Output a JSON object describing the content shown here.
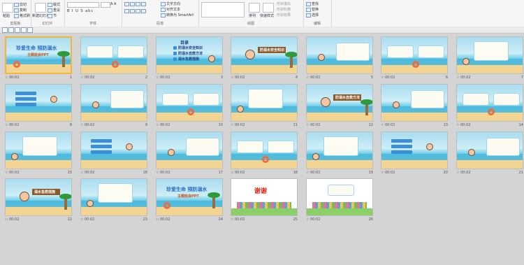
{
  "ribbon": {
    "groups": [
      {
        "label": "剪贴板",
        "items": [
          "剪切",
          "复制",
          "格式刷"
        ],
        "big": "粘贴"
      },
      {
        "label": "幻灯片",
        "items": [
          "版式",
          "重设",
          "节"
        ],
        "big": "新建幻灯片"
      },
      {
        "label": "字体",
        "items": [
          "A A",
          "B I U S abc"
        ]
      },
      {
        "label": "段落",
        "items": [
          "文字方向",
          "对齐文本",
          "转换为 SmartArt"
        ]
      },
      {
        "label": "绘图",
        "items": [
          "排列",
          "快速样式"
        ],
        "sub": [
          "形状填充",
          "形状轮廓",
          "形状效果"
        ]
      },
      {
        "label": "编辑",
        "items": [
          "查找",
          "替换",
          "选择"
        ]
      }
    ]
  },
  "slides": [
    {
      "n": "1",
      "time": "00:02",
      "title": "珍爱生命 预防溺水",
      "subtitle": "主题班会PPT"
    },
    {
      "n": "2",
      "time": "00:02"
    },
    {
      "n": "3",
      "time": "00:02",
      "title": "目录",
      "toc": [
        "防溺水安全知识",
        "防溺水自救方法",
        "溺水急救措施"
      ]
    },
    {
      "n": "4",
      "time": "00:02",
      "label": "防溺水安全知识"
    },
    {
      "n": "5",
      "time": "00:02"
    },
    {
      "n": "6",
      "time": "00:02"
    },
    {
      "n": "7",
      "time": "00:02"
    },
    {
      "n": "8",
      "time": "00:02"
    },
    {
      "n": "9",
      "time": "00:02"
    },
    {
      "n": "10",
      "time": "00:02"
    },
    {
      "n": "11",
      "time": "00:02"
    },
    {
      "n": "12",
      "time": "00:02",
      "label": "防溺水自救方法"
    },
    {
      "n": "13",
      "time": "00:02"
    },
    {
      "n": "14",
      "time": "00:02"
    },
    {
      "n": "15",
      "time": "00:02"
    },
    {
      "n": "16",
      "time": "00:02"
    },
    {
      "n": "17",
      "time": "00:02"
    },
    {
      "n": "18",
      "time": "00:02"
    },
    {
      "n": "19",
      "time": "00:02"
    },
    {
      "n": "20",
      "time": "00:02"
    },
    {
      "n": "21",
      "time": "00:02"
    },
    {
      "n": "22",
      "time": "00:02",
      "label": "溺水急救措施"
    },
    {
      "n": "23",
      "time": "00:02"
    },
    {
      "n": "24",
      "time": "00:02",
      "title": "珍爱生命 预防溺水",
      "subtitle": "主题班会PPT"
    },
    {
      "n": "25",
      "time": "00:02",
      "title": "谢谢"
    },
    {
      "n": "26",
      "time": "00:02"
    }
  ]
}
